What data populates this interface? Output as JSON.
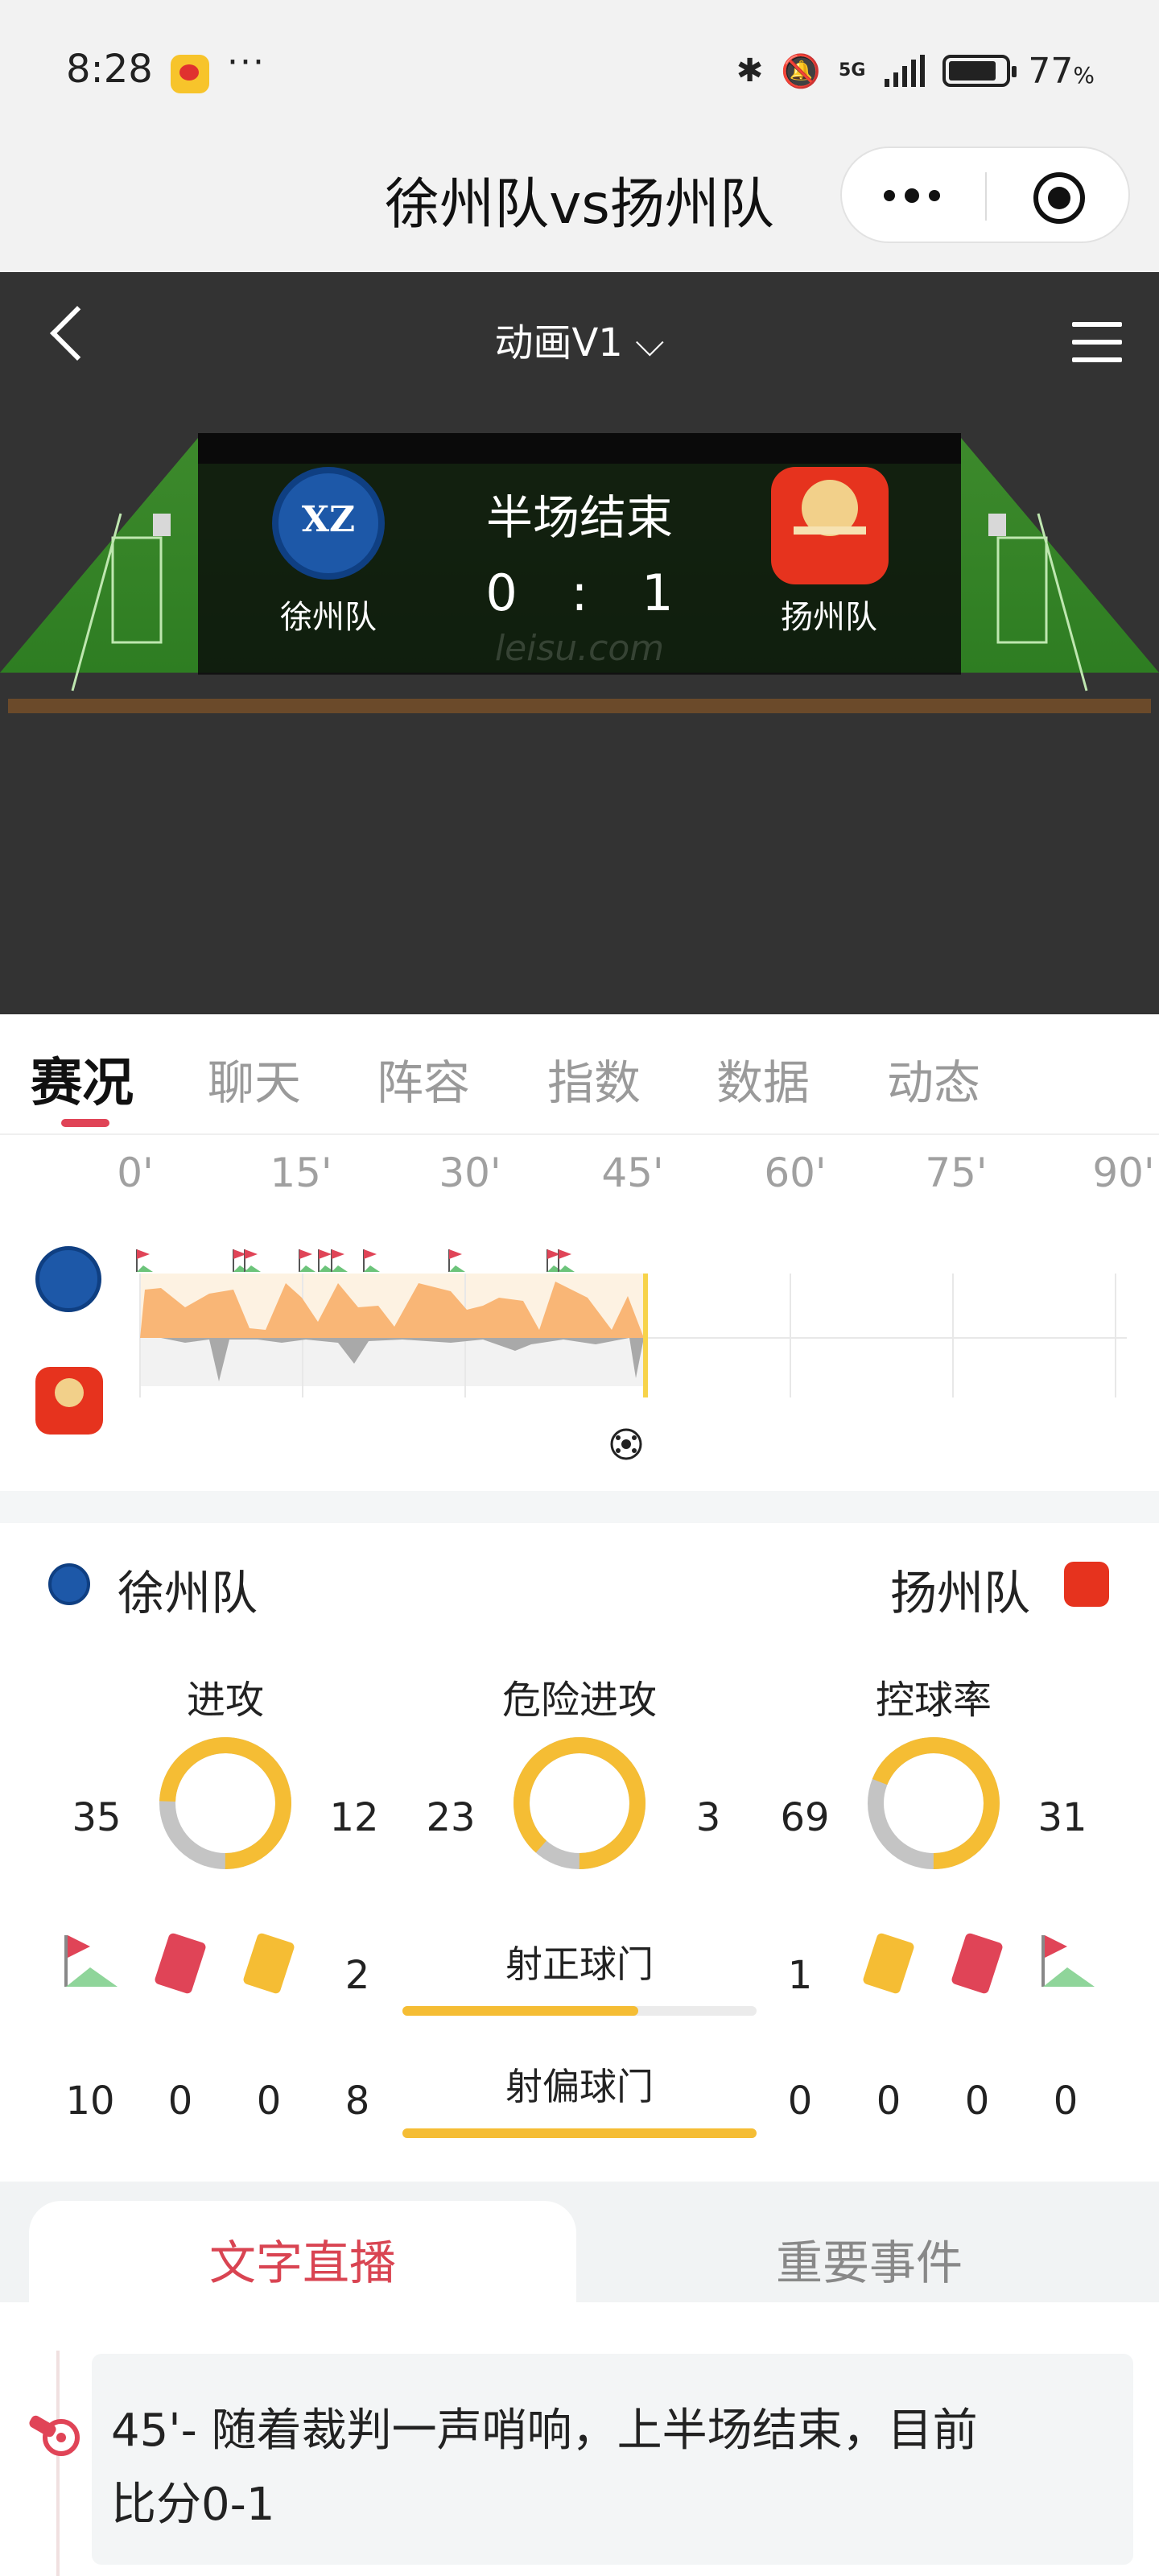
{
  "status_bar": {
    "time": "8:28",
    "dots": "···",
    "network": "5G",
    "battery": "77",
    "battery_unit": "%"
  },
  "title_bar": {
    "title": "徐州队vs扬州队"
  },
  "animation": {
    "mode_label": "动画V1",
    "match_status": "半场结束",
    "home": {
      "name": "徐州队",
      "score": "0"
    },
    "away": {
      "name": "扬州队",
      "score": "1"
    },
    "separator": ":",
    "watermark": "leisu.com"
  },
  "tabs": [
    "赛况",
    "聊天",
    "阵容",
    "指数",
    "数据",
    "动态"
  ],
  "timeline": {
    "ticks": [
      "0'",
      "15'",
      "30'",
      "45'",
      "60'",
      "75'",
      "90'"
    ],
    "elapsed_minute": 45,
    "goal_minute": 45
  },
  "stats": {
    "home_name": "徐州队",
    "away_name": "扬州队",
    "rings": [
      {
        "label": "进攻",
        "home": "35",
        "away": "12",
        "home_share": 0.745
      },
      {
        "label": "危险进攻",
        "home": "23",
        "away": "3",
        "home_share": 0.885
      },
      {
        "label": "控球率",
        "home": "69",
        "away": "31",
        "home_share": 0.69
      }
    ],
    "bars": [
      {
        "label": "射正球门",
        "home": "2",
        "away": "1",
        "home_share": 0.667
      },
      {
        "label": "射偏球门",
        "home": "8",
        "away": "0",
        "home_share": 1.0
      }
    ],
    "cards": {
      "home": {
        "corners": "10",
        "red": "0",
        "yellow": "0"
      },
      "away": {
        "corners": "0",
        "red": "0",
        "yellow": "0"
      }
    },
    "colors": {
      "home": "#f5bd34",
      "away": "#c4c4c4",
      "red_card": "#e04457",
      "yellow_card": "#f5bd34",
      "corner_flag": "#e04457"
    }
  },
  "bottom_tabs": [
    "文字直播",
    "重要事件"
  ],
  "commentary": {
    "text_line1": "45'- 随着裁判一声哨响，上半场结束，目前",
    "text_line2": "比分0-1"
  }
}
